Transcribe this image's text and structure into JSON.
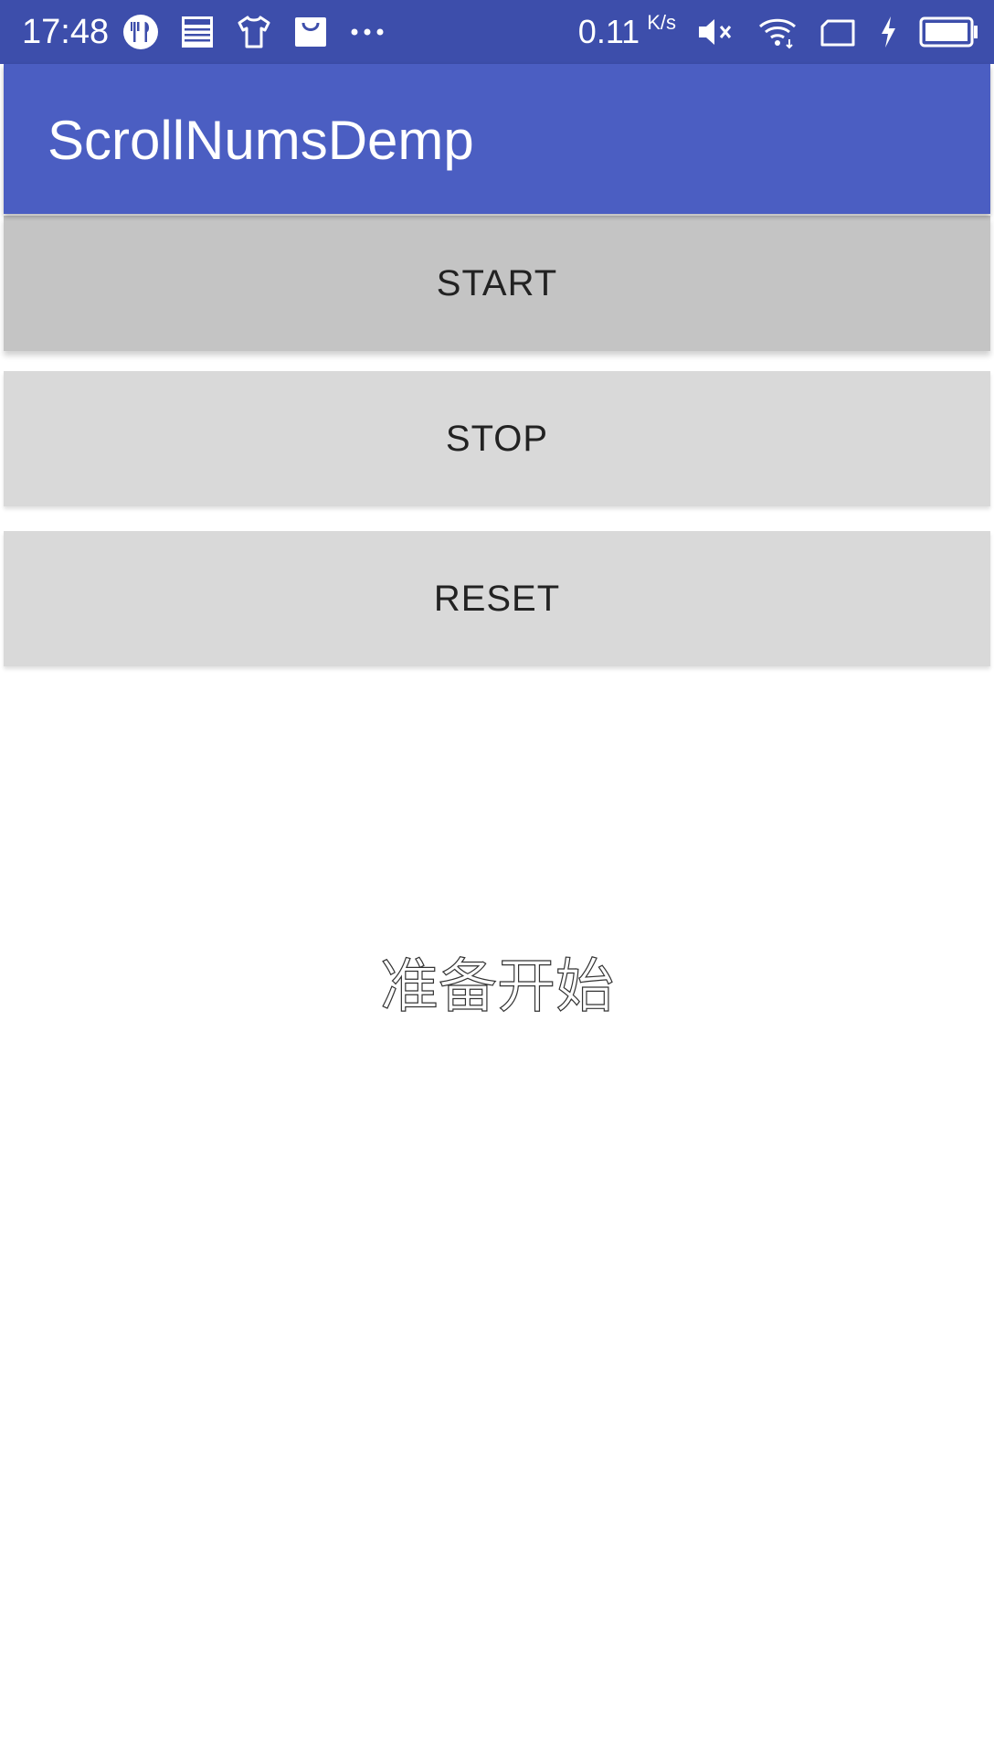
{
  "status_bar": {
    "time": "17:48",
    "net_speed": "0.11",
    "net_speed_unit": "K/s",
    "background": "#3d4eab",
    "icons_left": [
      "cutlery-icon",
      "news-icon",
      "tshirt-icon",
      "shopping-bag-icon",
      "more-dots-icon"
    ],
    "icons_right": [
      "mute-icon",
      "wifi-icon",
      "sim-card-icon",
      "charging-bolt-icon",
      "battery-icon"
    ]
  },
  "app_bar": {
    "title": "ScrollNumsDemp",
    "background": "#4b5ec2"
  },
  "buttons": {
    "start": "START",
    "stop": "STOP",
    "reset": "RESET"
  },
  "main": {
    "status_text": "准备开始"
  }
}
